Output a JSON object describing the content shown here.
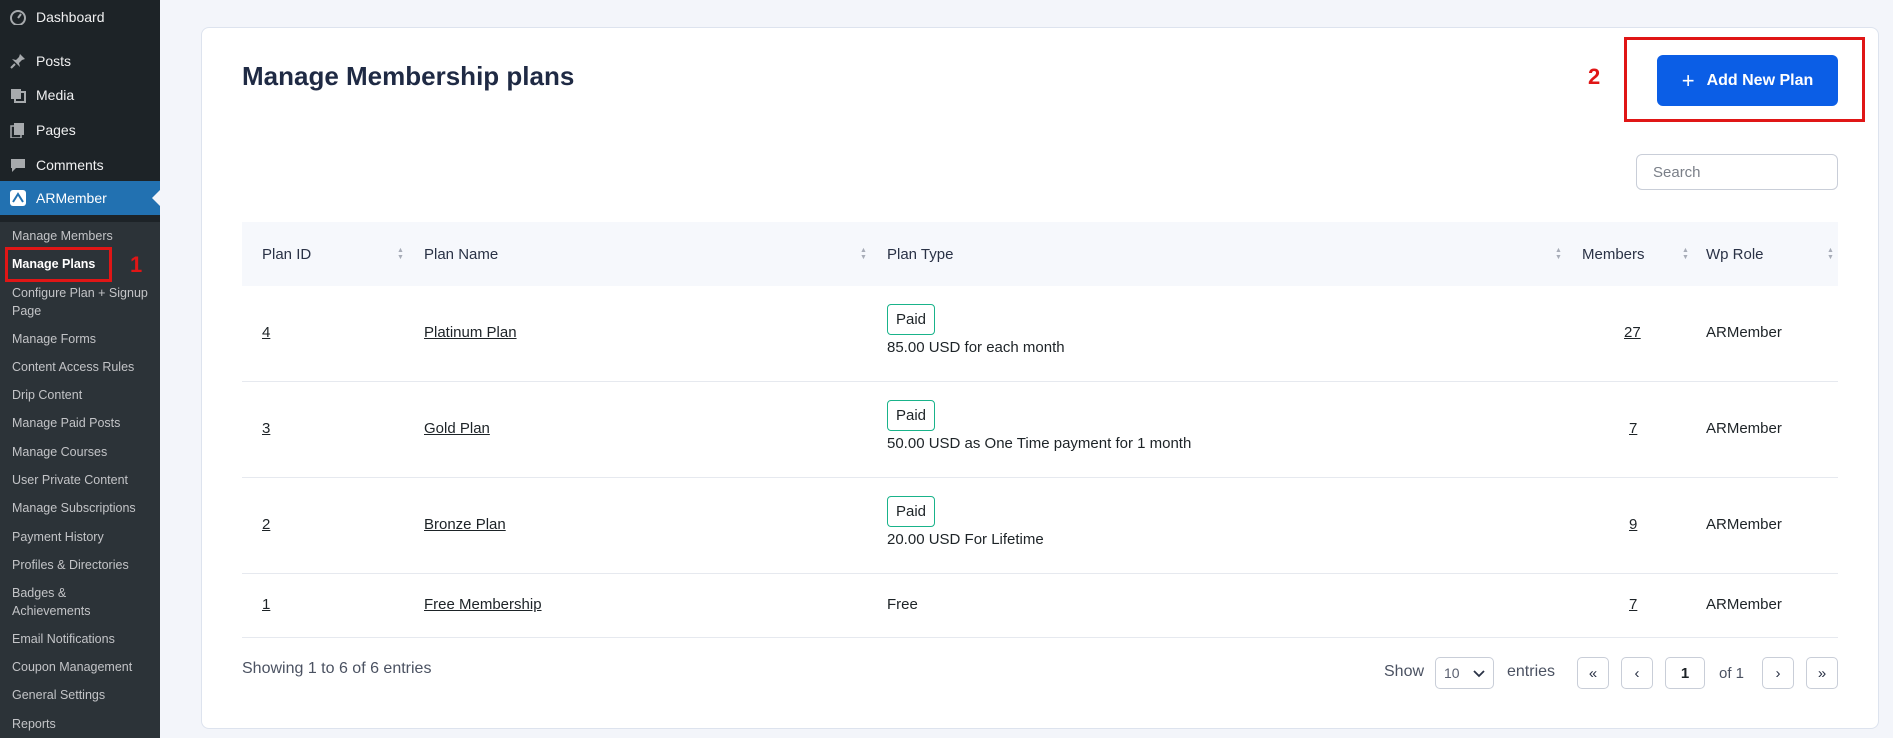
{
  "sidebar": {
    "menu": [
      {
        "label": "Dashboard",
        "icon": "dashboard-icon"
      },
      {
        "label": "Posts",
        "icon": "pin-icon"
      },
      {
        "label": "Media",
        "icon": "media-icon"
      },
      {
        "label": "Pages",
        "icon": "pages-icon"
      },
      {
        "label": "Comments",
        "icon": "comment-icon"
      },
      {
        "label": "ARMember",
        "icon": "armember-icon"
      }
    ],
    "submenu": [
      "Manage Members",
      "Manage Plans",
      "Configure Plan + Signup Page",
      "Manage Forms",
      "Content Access Rules",
      "Drip Content",
      "Manage Paid Posts",
      "Manage Courses",
      "User Private Content",
      "Manage Subscriptions",
      "Payment History",
      "Profiles & Directories",
      "Badges & Achievements",
      "Email Notifications",
      "Coupon Management",
      "General Settings",
      "Reports"
    ],
    "marker_1": "1"
  },
  "main": {
    "title": "Manage Membership plans",
    "add_button": "Add New Plan",
    "marker_2": "2",
    "search_placeholder": "Search",
    "columns": [
      "Plan ID",
      "Plan Name",
      "Plan Type",
      "Members",
      "Wp Role"
    ],
    "rows": [
      {
        "id": "4",
        "name": "Platinum Plan",
        "badge": "Paid",
        "type": "85.00 USD for each month",
        "members": "27",
        "role": "ARMember"
      },
      {
        "id": "3",
        "name": "Gold Plan",
        "badge": "Paid",
        "type": "50.00 USD as One Time payment for 1 month",
        "members": "7",
        "role": "ARMember"
      },
      {
        "id": "2",
        "name": "Bronze Plan",
        "badge": "Paid",
        "type": "20.00 USD For Lifetime",
        "members": "9",
        "role": "ARMember"
      },
      {
        "id": "1",
        "name": "Free Membership",
        "badge": "",
        "type": "Free",
        "members": "7",
        "role": "ARMember"
      }
    ],
    "footer": {
      "showing": "Showing 1 to 6 of 6 entries",
      "show_label": "Show",
      "page_size": "10",
      "entries_label": "entries",
      "first": "«",
      "prev": "‹",
      "page": "1",
      "of_label": "of 1",
      "next": "›",
      "last": "»"
    }
  },
  "colors": {
    "sidebar_bg": "#1d2327",
    "active_menu": "#2271b1",
    "primary_button": "#0b5ee6",
    "badge_border": "#19b38a",
    "annotation_red": "#e01616"
  }
}
